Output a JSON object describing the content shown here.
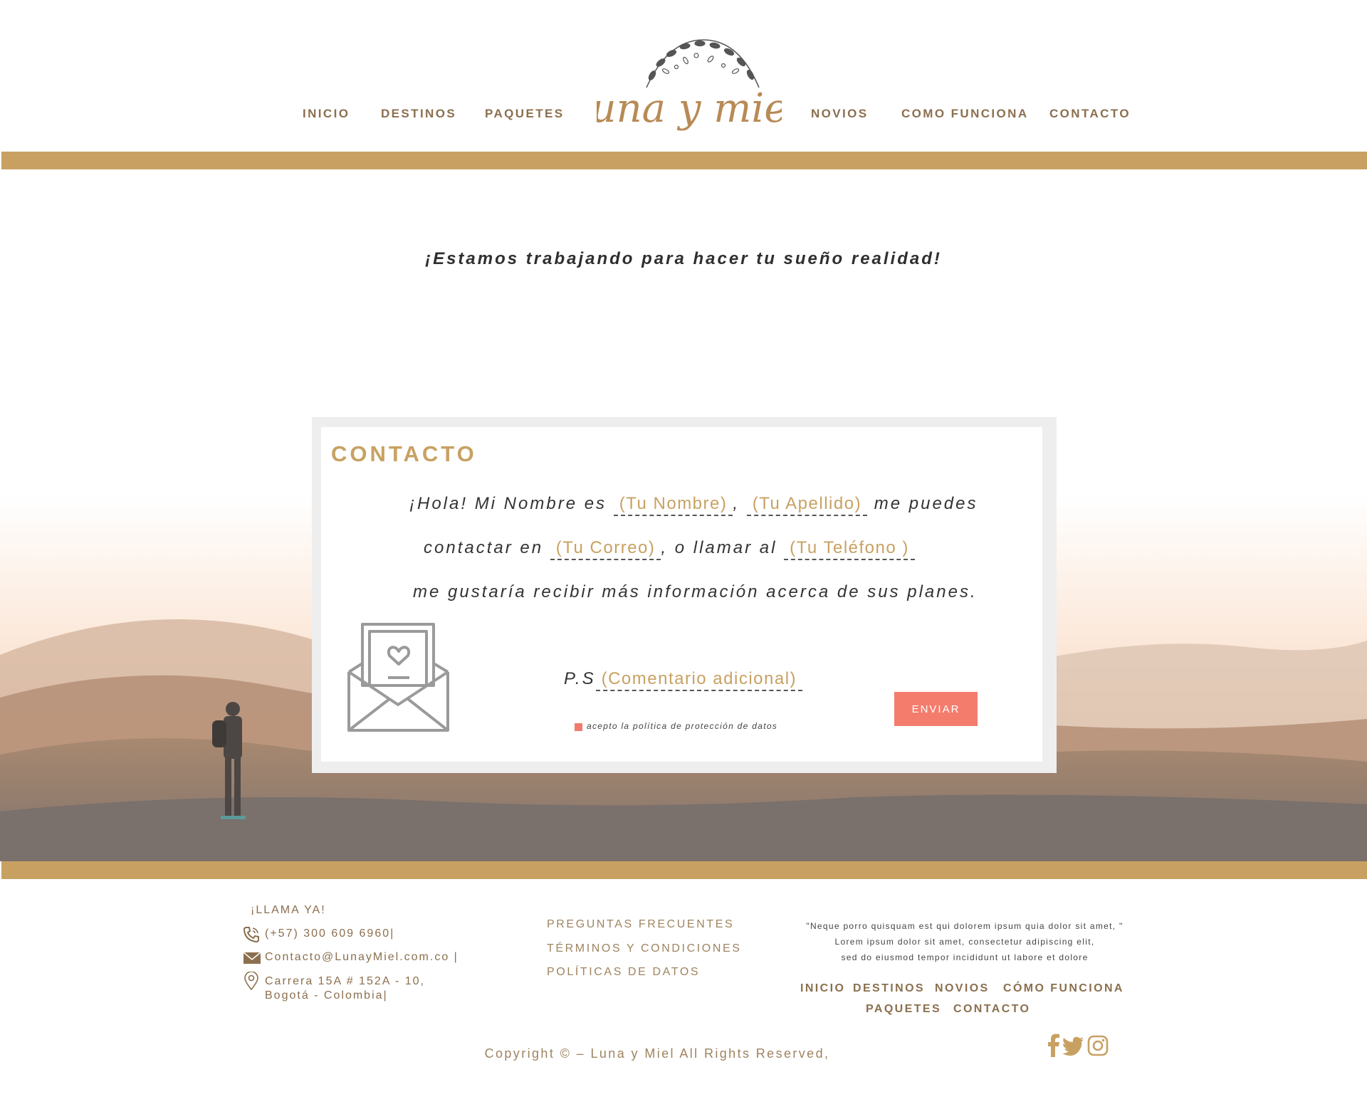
{
  "header": {
    "nav_left": [
      "INICIO",
      "DESTINOS",
      "PAQUETES"
    ],
    "nav_right": [
      "NOVIOS",
      "COMO FUNCIONA",
      "CONTACTO"
    ],
    "logo_text": "luna y miel"
  },
  "tagline": "¡Estamos trabajando para hacer tu sueño realidad!",
  "contact": {
    "title": "CONTACTO",
    "line1_a": "¡Hola! Mi Nombre es",
    "first_name_placeholder": "(Tu Nombre)",
    "line1_comma": ",",
    "last_name_placeholder": "(Tu Apellido)",
    "line1_b": "me puedes",
    "line2_a": "contactar en",
    "email_placeholder": "(Tu Correo)",
    "line2_b": ", o llamar al",
    "phone_placeholder": "(Tu Teléfono )",
    "line3": "me gustaría recibir más información acerca de sus planes.",
    "ps_label": "P.S",
    "comment_placeholder": "(Comentario adicional)",
    "checkbox_label": "acepto la política de protección de datos",
    "send_label": "ENVIAR"
  },
  "footer": {
    "call_title": "¡LLAMA YA!",
    "phone": "(+57) 300 609 6960|",
    "email": "Contacto@LunayMiel.com.co |",
    "address_line1": "Carrera 15A # 152A - 10,",
    "address_line2": "Bogotá - Colombia|",
    "links": [
      "PREGUNTAS FRECUENTES",
      "TÉRMINOS Y CONDICIONES",
      "POLÍTICAS DE DATOS"
    ],
    "quote_lines": [
      "\"Neque porro quisquam est qui dolorem ipsum quia dolor sit amet, \"",
      "Lorem ipsum dolor sit amet, consectetur adipiscing elit,",
      "sed do eiusmod tempor incididunt ut labore et dolore"
    ],
    "nav_row1": [
      "INICIO",
      "DESTINOS",
      "NOVIOS",
      "CÓMO FUNCIONA"
    ],
    "nav_row2": [
      "PAQUETES",
      "CONTACTO"
    ],
    "copyright": "Copyright © – Luna y Miel  All Rights Reserved,",
    "social_icons": [
      "facebook-icon",
      "twitter-icon",
      "instagram-icon"
    ]
  },
  "colors": {
    "gold": "#c8a162",
    "brown_text": "#8b6f4e",
    "button": "#f47c6d"
  }
}
